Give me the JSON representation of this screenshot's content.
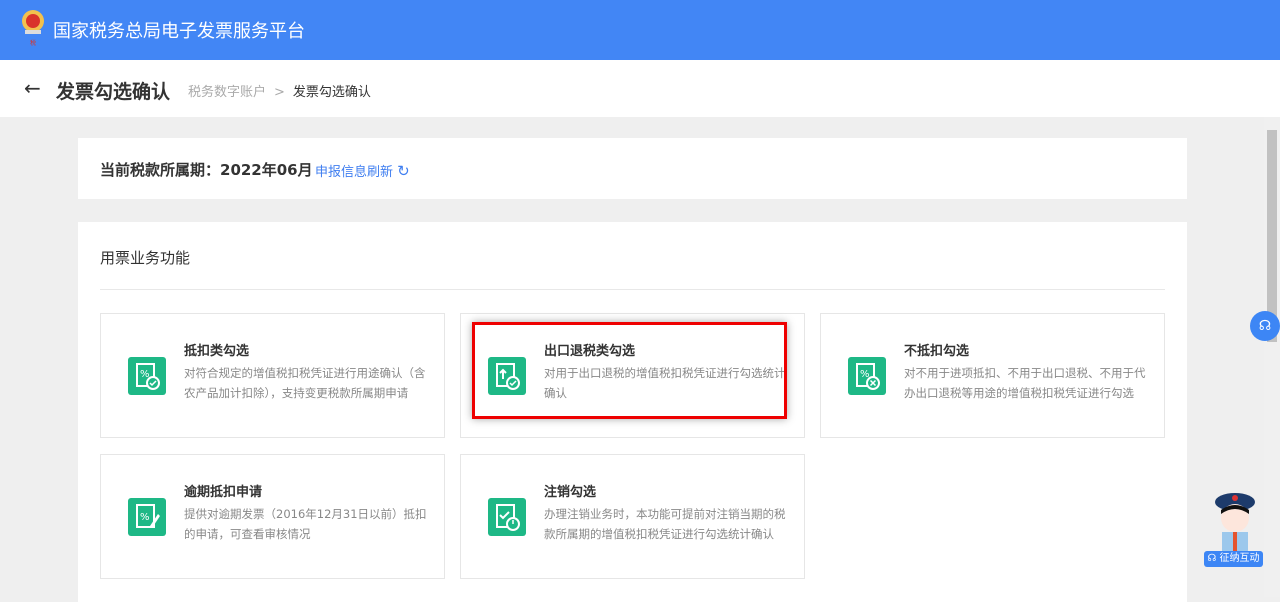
{
  "header": {
    "title": "国家税务总局电子发票服务平台",
    "logo_text": "中国税务"
  },
  "subheader": {
    "title": "发票勾选确认",
    "breadcrumb": [
      "税务数字账户",
      "发票勾选确认"
    ],
    "sep": ">"
  },
  "period": {
    "label": "当前税款所属期：2022年06月",
    "refresh": "申报信息刷新"
  },
  "section": {
    "title": "用票业务功能",
    "tiles": [
      {
        "title": "抵扣类勾选",
        "desc": "对符合规定的增值税扣税凭证进行用途确认（含农产品加计扣除），支持变更税款所属期申请",
        "icon": "percent-check-icon"
      },
      {
        "title": "出口退税类勾选",
        "desc": "对用于出口退税的增值税扣税凭证进行勾选统计确认",
        "icon": "upload-check-icon",
        "highlighted": true
      },
      {
        "title": "不抵扣勾选",
        "desc": "对不用于进项抵扣、不用于出口退税、不用于代办出口退税等用途的增值税扣税凭证进行勾选",
        "icon": "percent-cross-icon"
      },
      {
        "title": "逾期抵扣申请",
        "desc": "提供对逾期发票（2016年12月31日以前）抵扣的申请，可查看审核情况",
        "icon": "edit-percent-icon"
      },
      {
        "title": "注销勾选",
        "desc": "办理注销业务时，本功能可提前对注销当期的税款所属期的增值税扣税凭证进行勾选统计确认",
        "icon": "check-power-icon"
      }
    ]
  },
  "service": {
    "label": "征纳互动"
  },
  "colors": {
    "header": "#4286f5",
    "icon": "#1eb886",
    "highlight": "#e00000"
  }
}
